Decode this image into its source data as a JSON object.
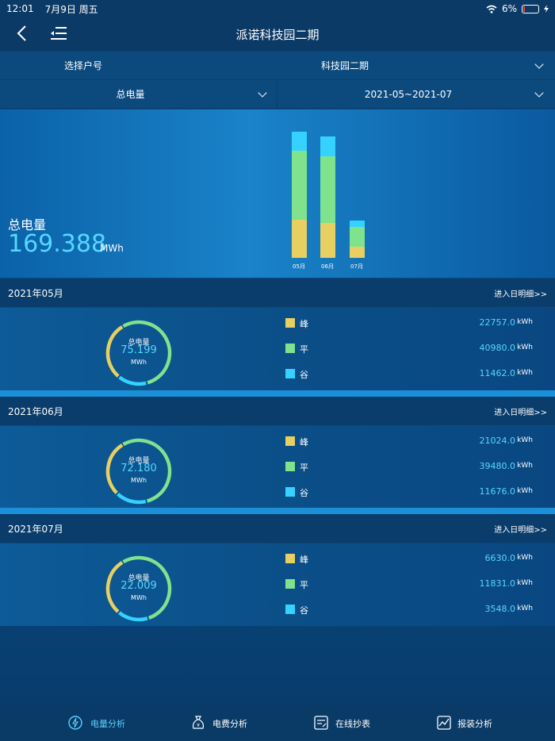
{
  "status_bar": {
    "time": "12:01",
    "date": "7月9日 周五",
    "battery": "6%"
  },
  "nav": {
    "title": "派诺科技园二期"
  },
  "filters": {
    "account_label": "选择户号",
    "account_value": "科技园二期",
    "metric_value": "总电量",
    "date_range": "2021-05~2021-07"
  },
  "summary": {
    "label": "总电量",
    "value": "169.388",
    "unit": "MWh"
  },
  "colors": {
    "peak": "#e8cf62",
    "flat": "#7fe38d",
    "valley": "#35d2ff",
    "accent": "#56d7ff"
  },
  "chart_data": {
    "type": "bar",
    "stacked": true,
    "categories": [
      "05月",
      "06月",
      "07月"
    ],
    "series": [
      {
        "name": "峰",
        "values": [
          22757.0,
          21024.0,
          6630.0
        ]
      },
      {
        "name": "平",
        "values": [
          40980.0,
          39480.0,
          11831.0
        ]
      },
      {
        "name": "谷",
        "values": [
          11462.0,
          11676.0,
          3548.0
        ]
      }
    ],
    "ylim": [
      0,
      75199
    ]
  },
  "months": [
    {
      "title": "2021年05月",
      "link": "进入日明细>>",
      "total_label": "总电量",
      "total": "75.199",
      "total_unit": "MWh",
      "rows": [
        {
          "name": "峰",
          "value": "22757.0",
          "unit": "kWh"
        },
        {
          "name": "平",
          "value": "40980.0",
          "unit": "kWh"
        },
        {
          "name": "谷",
          "value": "11462.0",
          "unit": "kWh"
        }
      ]
    },
    {
      "title": "2021年06月",
      "link": "进入日明细>>",
      "total_label": "总电量",
      "total": "72.180",
      "total_unit": "MWh",
      "rows": [
        {
          "name": "峰",
          "value": "21024.0",
          "unit": "kWh"
        },
        {
          "name": "平",
          "value": "39480.0",
          "unit": "kWh"
        },
        {
          "name": "谷",
          "value": "11676.0",
          "unit": "kWh"
        }
      ]
    },
    {
      "title": "2021年07月",
      "link": "进入日明细>>",
      "total_label": "总电量",
      "total": "22.009",
      "total_unit": "MWh",
      "rows": [
        {
          "name": "峰",
          "value": "6630.0",
          "unit": "kWh"
        },
        {
          "name": "平",
          "value": "11831.0",
          "unit": "kWh"
        },
        {
          "name": "谷",
          "value": "3548.0",
          "unit": "kWh"
        }
      ]
    }
  ],
  "tabs": [
    {
      "label": "电量分析",
      "icon": "lightning-icon",
      "active": true
    },
    {
      "label": "电费分析",
      "icon": "money-bag-icon",
      "active": false
    },
    {
      "label": "在线抄表",
      "icon": "meter-reading-icon",
      "active": false
    },
    {
      "label": "报装分析",
      "icon": "trend-chart-icon",
      "active": false
    }
  ]
}
